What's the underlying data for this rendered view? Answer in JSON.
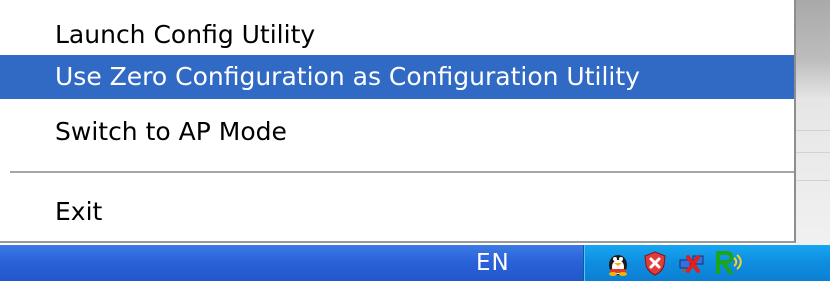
{
  "context_menu": {
    "items": [
      {
        "label": "Launch Config Utility",
        "selected": false
      },
      {
        "label": "Use Zero Configuration as Configuration Utility",
        "selected": true
      },
      {
        "label": "Switch to AP Mode",
        "selected": false
      },
      {
        "label": "Exit",
        "selected": false
      }
    ],
    "highlight_color": "#316ac5"
  },
  "taskbar": {
    "language_indicator": "EN",
    "background_color": "#2a62d8",
    "tray_color": "#0f8de0",
    "tray_icons": [
      "messenger-penguin-icon",
      "security-shield-icon",
      "network-disconnected-icon",
      "wireless-utility-icon"
    ]
  }
}
